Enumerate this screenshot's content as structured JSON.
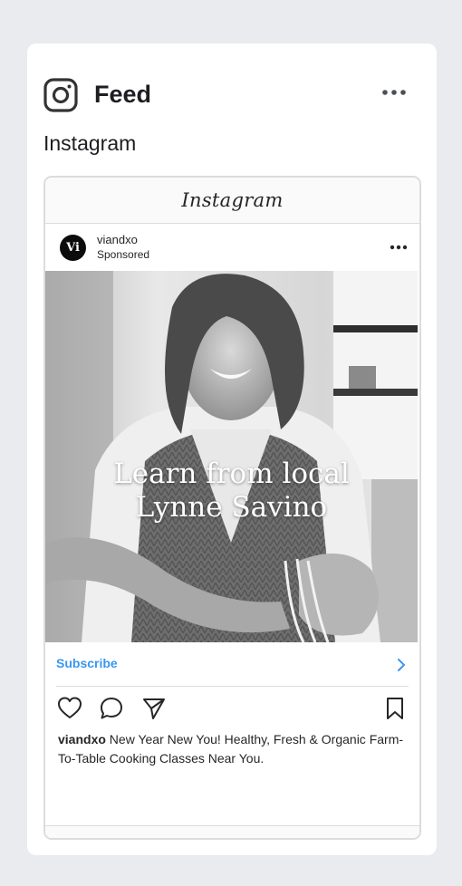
{
  "header": {
    "title": "Feed",
    "platform": "Instagram",
    "logo_icon": "instagram-icon",
    "more_icon": "more-horizontal-icon"
  },
  "preview": {
    "wordmark": "Instagram",
    "post": {
      "account": "viandxo",
      "avatar_text": "Vi",
      "sponsored": "Sponsored",
      "image_headline_line1": "Learn from local",
      "image_headline_line2": "Lynne Savino",
      "cta_label": "Subscribe",
      "cta_color": "#3897f0",
      "caption_user": "viandxo",
      "caption_text": "New Year New You! Healthy, Fresh & Organic Farm-To-Table Cooking Classes Near You."
    },
    "actions": [
      "heart-icon",
      "comment-icon",
      "share-icon",
      "bookmark-icon"
    ]
  },
  "colors": {
    "page_background": "#e9ebee",
    "card_background": "#ffffff",
    "text": "#1c1e21"
  }
}
